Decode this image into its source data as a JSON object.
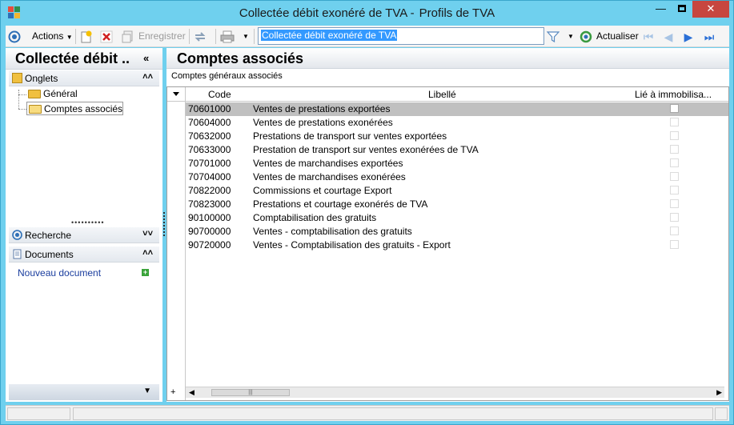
{
  "window": {
    "title_main": "Collectée débit exonéré de TVA -",
    "title_sub": "Profils de TVA",
    "btn_min": "—",
    "btn_close": "✕"
  },
  "toolbar": {
    "actions_label": "Actions",
    "save_label": "Enregistrer",
    "search_value": "Collectée débit exonéré de TVA",
    "refresh_label": "Actualiser"
  },
  "left_panel": {
    "title": "Collectée débit ..",
    "collapse_glyph": "«",
    "sections": {
      "onglets": "Onglets",
      "recherche": "Recherche",
      "documents": "Documents"
    },
    "tree": [
      {
        "label": "Général"
      },
      {
        "label": "Comptes associés"
      }
    ],
    "new_document": "Nouveau document"
  },
  "main": {
    "title": "Comptes associés",
    "subtitle": "Comptes généraux associés",
    "columns": {
      "code": "Code",
      "libelle": "Libellé",
      "immo": "Lié à immobilisa..."
    },
    "rows": [
      {
        "code": "70601000",
        "libelle": "Ventes de prestations exportées",
        "immo": false
      },
      {
        "code": "70604000",
        "libelle": "Ventes de prestations exonérées",
        "immo": false
      },
      {
        "code": "70632000",
        "libelle": "Prestations de transport sur ventes exportées",
        "immo": false
      },
      {
        "code": "70633000",
        "libelle": "Prestation de transport sur ventes exonérées de TVA",
        "immo": false
      },
      {
        "code": "70701000",
        "libelle": "Ventes de marchandises exportées",
        "immo": false
      },
      {
        "code": "70704000",
        "libelle": "Ventes de marchandises exonérées",
        "immo": false
      },
      {
        "code": "70822000",
        "libelle": "Commissions et courtage Export",
        "immo": false
      },
      {
        "code": "70823000",
        "libelle": "Prestations et courtage exonérés de TVA",
        "immo": false
      },
      {
        "code": "90100000",
        "libelle": "Comptabilisation des gratuits",
        "immo": false
      },
      {
        "code": "90700000",
        "libelle": "Ventes - comptabilisation des gratuits",
        "immo": false
      },
      {
        "code": "90720000",
        "libelle": "Ventes - Comptabilisation des gratuits - Export",
        "immo": false
      }
    ],
    "selected_row": 0
  },
  "colors": {
    "window_frame": "#6fd0ee",
    "close_button": "#c7463f",
    "selected_row": "#c0c0c0",
    "link": "#1a3d9e"
  }
}
